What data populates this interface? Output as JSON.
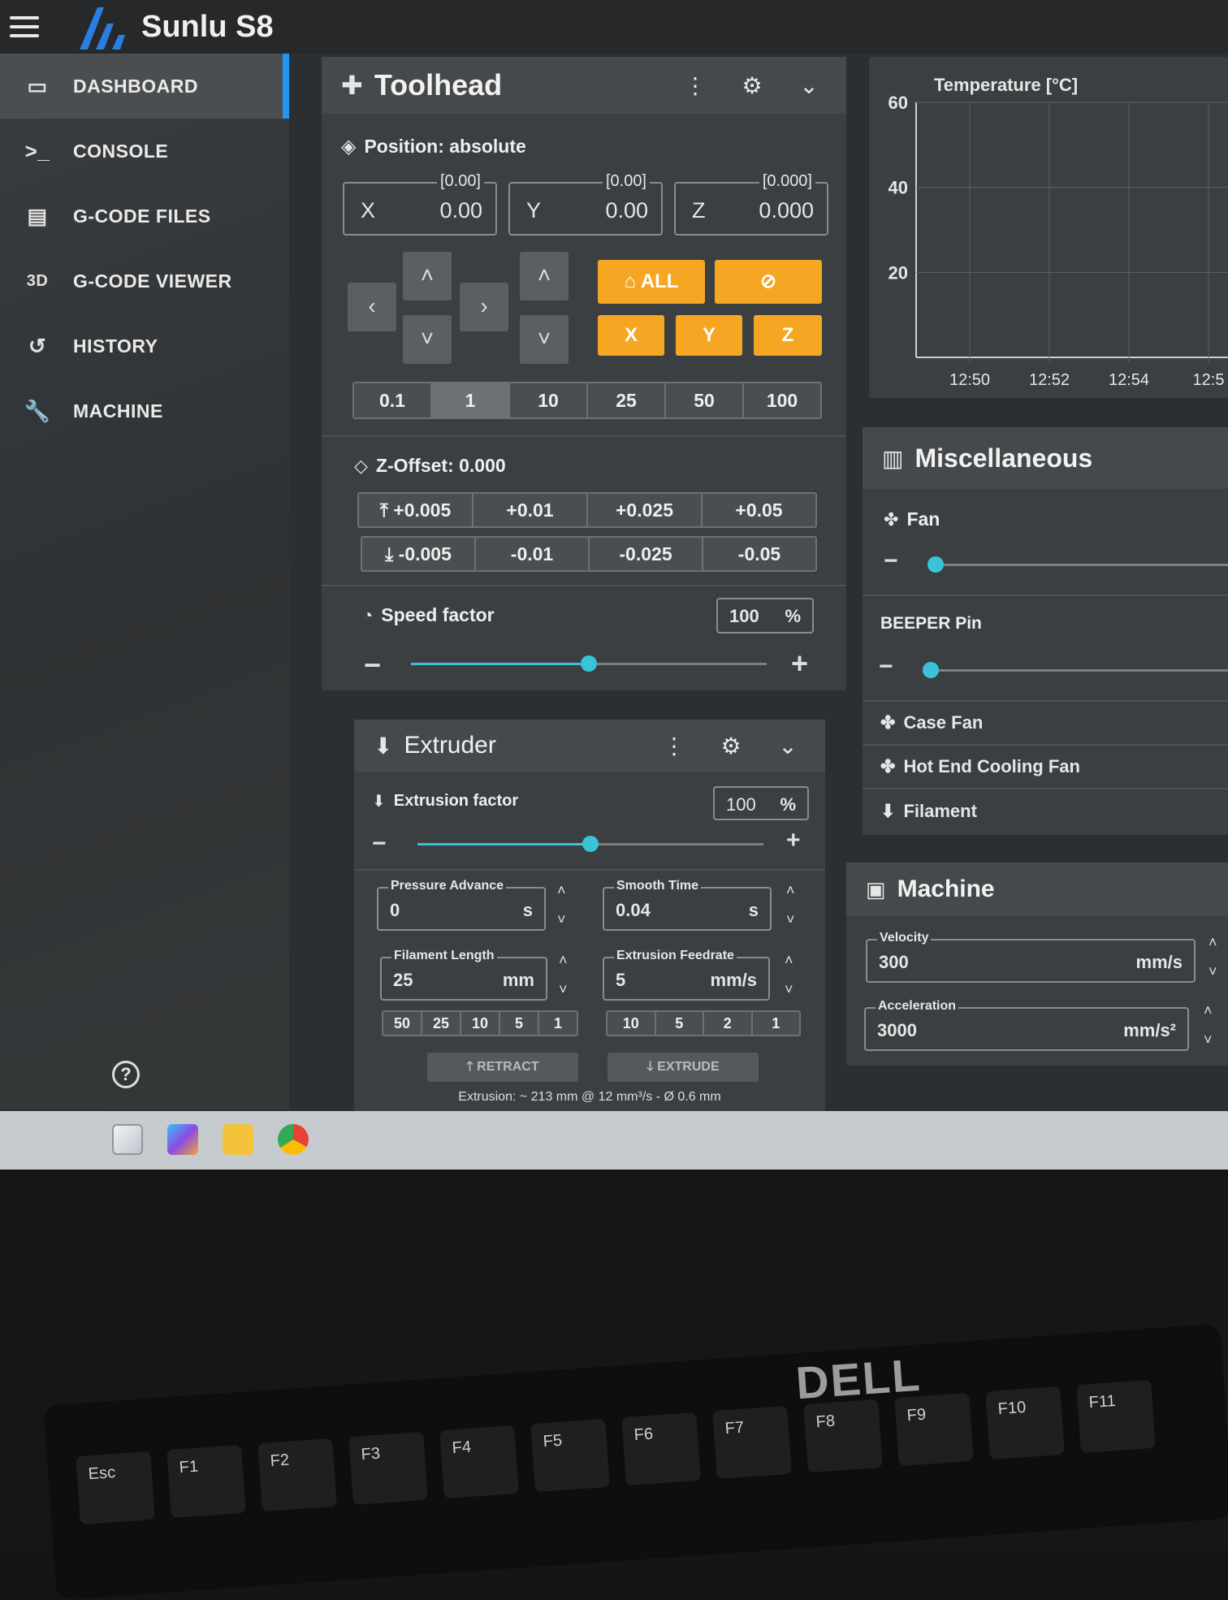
{
  "app": {
    "title": "Sunlu S8"
  },
  "sidebar": {
    "items": [
      {
        "label": "DASHBOARD",
        "icon": "monitor-dashboard-icon",
        "active": true
      },
      {
        "label": "CONSOLE",
        "icon": "console-icon"
      },
      {
        "label": "G-CODE FILES",
        "icon": "file-document-icon"
      },
      {
        "label": "G-CODE VIEWER",
        "icon": "3d-icon",
        "icon_text": "3D"
      },
      {
        "label": "HISTORY",
        "icon": "history-icon"
      },
      {
        "label": "MACHINE",
        "icon": "wrench-icon"
      }
    ]
  },
  "toolhead": {
    "title": "Toolhead",
    "position_label": "Position: absolute",
    "x": {
      "label": "X",
      "value": "0.00",
      "target": "[0.00]"
    },
    "y": {
      "label": "Y",
      "value": "0.00",
      "target": "[0.00]"
    },
    "z": {
      "label": "Z",
      "value": "0.000",
      "target": "[0.000]"
    },
    "home_all": "ALL",
    "home_x": "X",
    "home_y": "Y",
    "home_z": "Z",
    "steps": [
      "0.1",
      "1",
      "10",
      "25",
      "50",
      "100"
    ],
    "selected_step": "1",
    "zoffset_label": "Z-Offset: 0.000",
    "zoffset_up": [
      "+0.005",
      "+0.01",
      "+0.025",
      "+0.05"
    ],
    "zoffset_down": [
      "-0.005",
      "-0.01",
      "-0.025",
      "-0.05"
    ],
    "speed_label": "Speed factor",
    "speed_value": "100",
    "speed_unit": "%",
    "speed_fraction": 0.5
  },
  "extruder": {
    "title": "Extruder",
    "factor_label": "Extrusion factor",
    "factor_value": "100",
    "factor_unit": "%",
    "factor_fraction": 0.5,
    "pressure_advance": {
      "label": "Pressure Advance",
      "value": "0",
      "unit": "s"
    },
    "smooth_time": {
      "label": "Smooth Time",
      "value": "0.04",
      "unit": "s"
    },
    "filament_length": {
      "label": "Filament Length",
      "value": "25",
      "unit": "mm"
    },
    "extrusion_feedrate": {
      "label": "Extrusion Feedrate",
      "value": "5",
      "unit": "mm/s"
    },
    "length_steps": [
      "50",
      "25",
      "10",
      "5",
      "1"
    ],
    "feedrate_steps": [
      "10",
      "5",
      "2",
      "1"
    ],
    "retract_label": "RETRACT",
    "extrude_label": "EXTRUDE",
    "info": "Extrusion: ~ 213 mm @ 12 mm³/s - Ø 0.6 mm"
  },
  "temperature": {
    "title": "Temperature [°C]"
  },
  "chart_data": {
    "type": "line",
    "title": "Temperature [°C]",
    "x": [
      "12:50",
      "12:52",
      "12:54",
      "12:5"
    ],
    "ylim": [
      0,
      60
    ],
    "yticks": [
      "60",
      "40",
      "20"
    ],
    "series": [],
    "grid": true
  },
  "misc": {
    "title": "Miscellaneous",
    "fan_label": "Fan",
    "fan_fraction": 0.0,
    "beeper_label": "BEEPER Pin",
    "beeper_fraction": 0.0,
    "case_fan_label": "Case Fan",
    "hotend_fan_label": "Hot End Cooling Fan",
    "filament_label": "Filament"
  },
  "machine": {
    "title": "Machine",
    "velocity": {
      "label": "Velocity",
      "value": "300",
      "unit": "mm/s"
    },
    "acceleration": {
      "label": "Acceleration",
      "value": "3000",
      "unit": "mm/s²"
    }
  },
  "keyboard": {
    "brand": "DELL",
    "keys": [
      "Esc",
      "F1",
      "F2",
      "F3",
      "F4",
      "F5",
      "F6",
      "F7",
      "F8",
      "F9",
      "F10",
      "F11"
    ]
  },
  "colors": {
    "accent": "#2196f3",
    "home_button": "#f5a623",
    "slider": "#3ac3d8"
  }
}
